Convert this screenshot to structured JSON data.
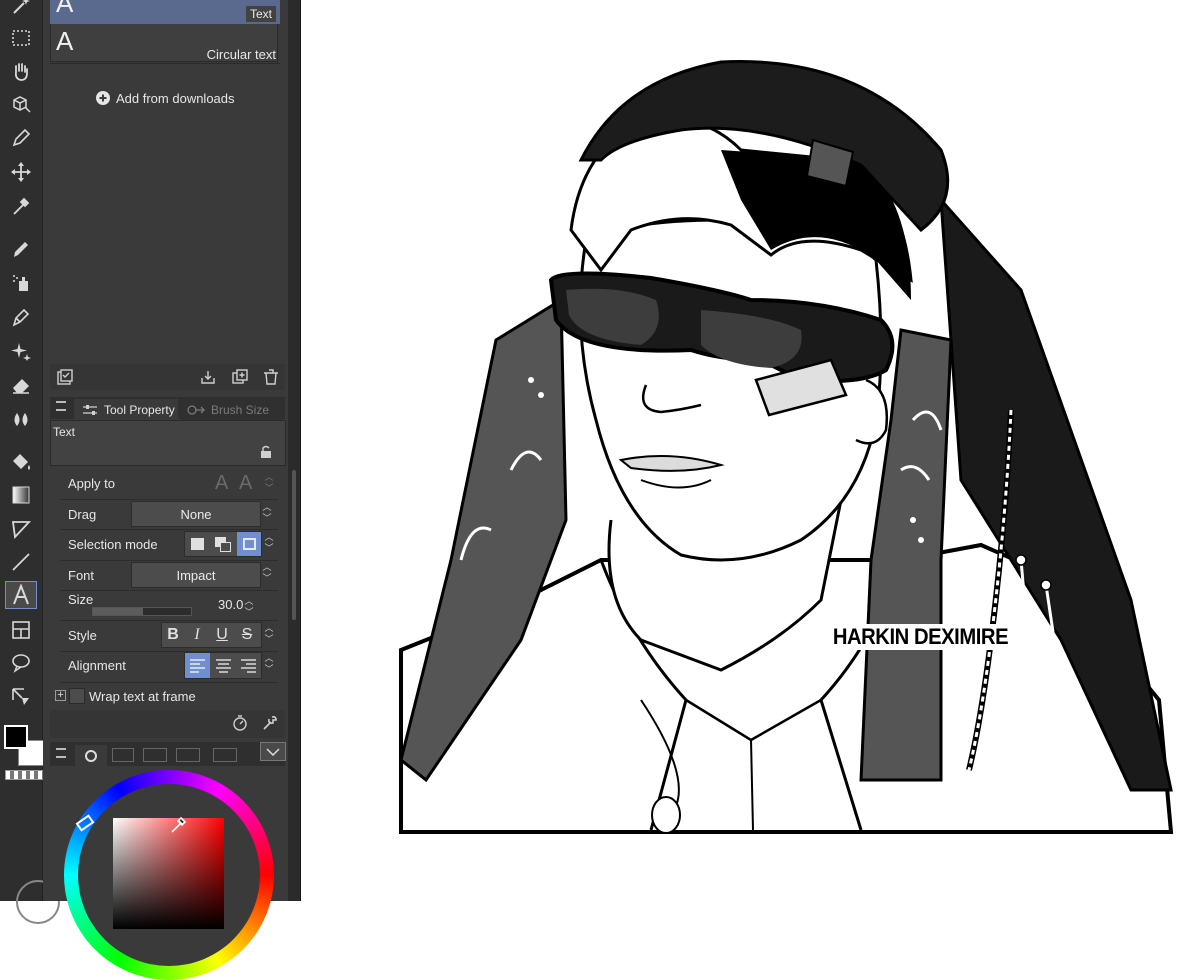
{
  "subtools": {
    "items": [
      {
        "label": "Text"
      },
      {
        "label": "Circular text"
      }
    ],
    "add_label": "Add from downloads"
  },
  "tabs": {
    "tool_property": "Tool Property",
    "brush_size": "Brush Size"
  },
  "tool_property": {
    "tool_name": "Text",
    "apply_to_label": "Apply to",
    "drag_label": "Drag",
    "drag_value": "None",
    "selection_mode_label": "Selection mode",
    "font_label": "Font",
    "font_value": "Impact",
    "size_label": "Size",
    "size_value": "30.0",
    "style_label": "Style",
    "alignment_label": "Alignment",
    "wrap_label": "Wrap text at frame"
  },
  "style_buttons": [
    "B",
    "I",
    "U",
    "S"
  ],
  "canvas": {
    "text_layer": "HARKIN DEXIMIRE"
  },
  "colors": {
    "main": "#000000",
    "sub": "#ffffff",
    "accent": "#6f8fd0",
    "selected_row": "#5a6a8e"
  }
}
